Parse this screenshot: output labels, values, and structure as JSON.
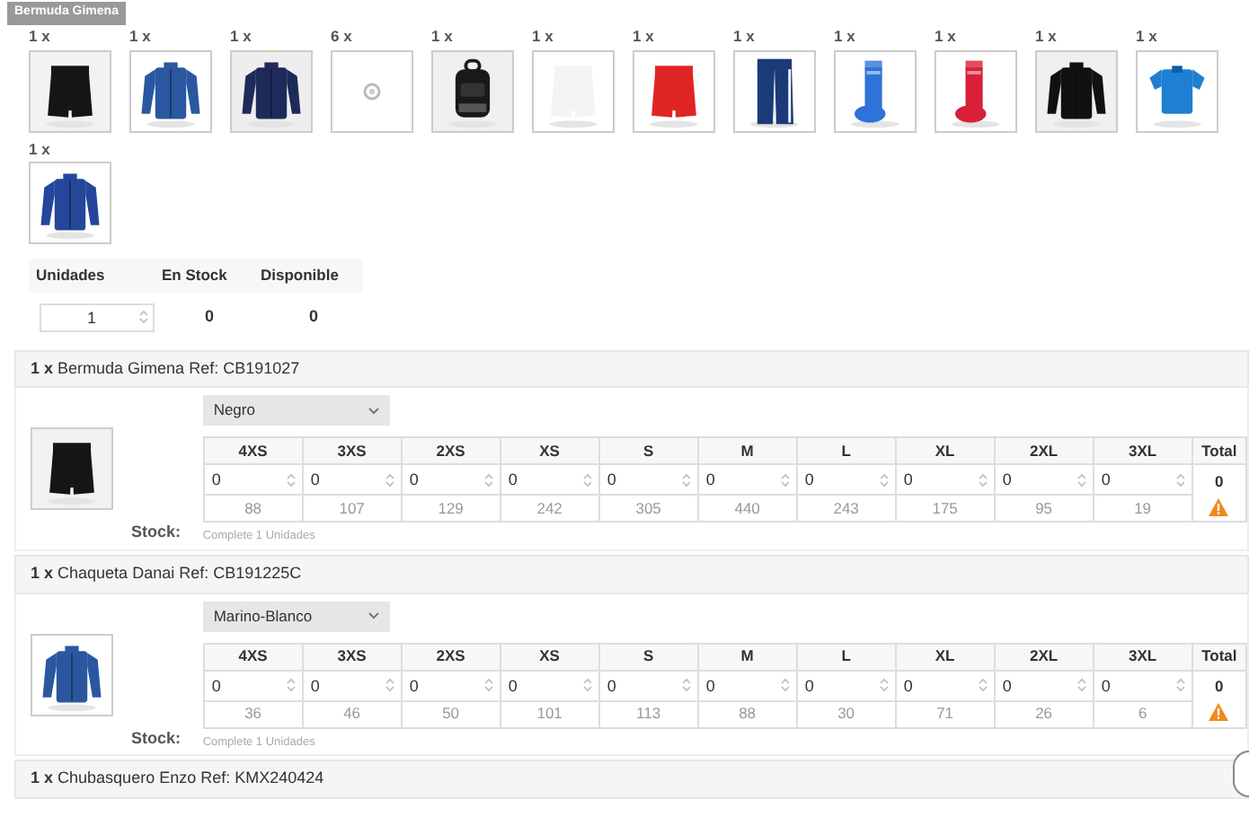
{
  "tooltip": "Bermuda Gimena",
  "thumbnails": [
    {
      "quantity": "1 x",
      "kind": "picture"
    },
    {
      "quantity": "1 x",
      "kind": "picture"
    },
    {
      "quantity": "1 x",
      "kind": "picture"
    },
    {
      "quantity": "6 x",
      "kind": "placeholder"
    },
    {
      "quantity": "1 x",
      "kind": "picture"
    },
    {
      "quantity": "1 x",
      "kind": "picture"
    },
    {
      "quantity": "1 x",
      "kind": "picture"
    },
    {
      "quantity": "1 x",
      "kind": "picture"
    },
    {
      "quantity": "1 x",
      "kind": "picture"
    },
    {
      "quantity": "1 x",
      "kind": "picture"
    },
    {
      "quantity": "1 x",
      "kind": "picture"
    },
    {
      "quantity": "1 x",
      "kind": "picture"
    },
    {
      "quantity": "1 x",
      "kind": "picture"
    }
  ],
  "summary": {
    "columns": [
      "Unidades",
      "En Stock",
      "Disponible"
    ],
    "units": "1",
    "in_stock": "0",
    "available": "0"
  },
  "products": [
    {
      "quantity": "1 x",
      "name": "Bermuda Gimena Ref: CB191027",
      "variant": "Negro",
      "stock_label": "Stock:",
      "note": "Complete 1 Unidades",
      "total_label": "Total",
      "total": "0",
      "warning": true,
      "sizes": [
        {
          "label": "4XS",
          "value": "0",
          "stock": "88"
        },
        {
          "label": "3XS",
          "value": "0",
          "stock": "107"
        },
        {
          "label": "2XS",
          "value": "0",
          "stock": "129"
        },
        {
          "label": "XS",
          "value": "0",
          "stock": "242"
        },
        {
          "label": "S",
          "value": "0",
          "stock": "305"
        },
        {
          "label": "M",
          "value": "0",
          "stock": "440"
        },
        {
          "label": "L",
          "value": "0",
          "stock": "243"
        },
        {
          "label": "XL",
          "value": "0",
          "stock": "175"
        },
        {
          "label": "2XL",
          "value": "0",
          "stock": "95"
        },
        {
          "label": "3XL",
          "value": "0",
          "stock": "19"
        }
      ]
    },
    {
      "quantity": "1 x",
      "name": "Chaqueta Danai Ref: CB191225C",
      "variant": "Marino-Blanco",
      "stock_label": "Stock:",
      "note": "Complete 1 Unidades",
      "total_label": "Total",
      "total": "0",
      "warning": true,
      "sizes": [
        {
          "label": "4XS",
          "value": "0",
          "stock": "36"
        },
        {
          "label": "3XS",
          "value": "0",
          "stock": "46"
        },
        {
          "label": "2XS",
          "value": "0",
          "stock": "50"
        },
        {
          "label": "XS",
          "value": "0",
          "stock": "101"
        },
        {
          "label": "S",
          "value": "0",
          "stock": "113"
        },
        {
          "label": "M",
          "value": "0",
          "stock": "88"
        },
        {
          "label": "L",
          "value": "0",
          "stock": "30"
        },
        {
          "label": "XL",
          "value": "0",
          "stock": "71"
        },
        {
          "label": "2XL",
          "value": "0",
          "stock": "26"
        },
        {
          "label": "3XL",
          "value": "0",
          "stock": "6"
        }
      ]
    },
    {
      "quantity": "1 x",
      "name": "Chubasquero Enzo Ref: KMX240424"
    }
  ]
}
